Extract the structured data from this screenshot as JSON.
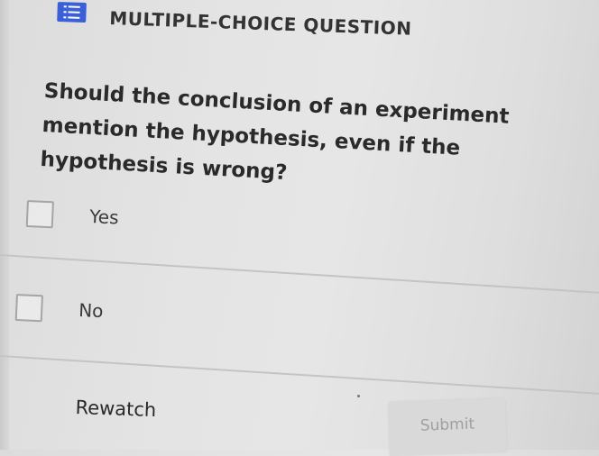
{
  "header": {
    "icon": "list-icon",
    "title": "MULTIPLE-CHOICE QUESTION"
  },
  "question": {
    "text": "Should the conclusion of an experiment mention the hypothesis, even if the hypothesis is wrong?"
  },
  "options": [
    {
      "label": "Yes",
      "checked": false
    },
    {
      "label": "No",
      "checked": false
    }
  ],
  "actions": {
    "rewatch_label": "Rewatch",
    "submit_label": "Submit",
    "submit_enabled": false
  },
  "colors": {
    "icon_bg": "#3b5fd9",
    "background": "#e2e2e2",
    "checkbox_border": "#a5a5a5",
    "submit_bg": "#d9d9d9",
    "submit_text": "#a0a0a0"
  }
}
